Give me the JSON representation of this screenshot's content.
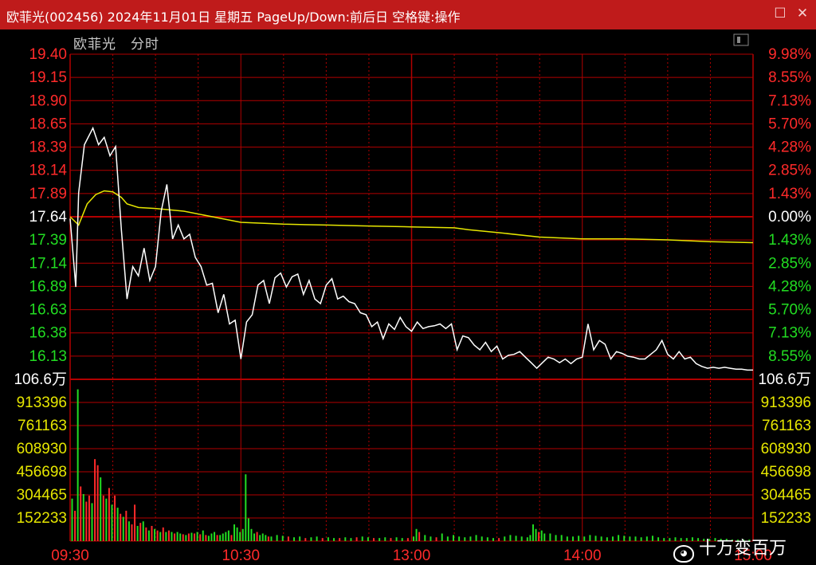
{
  "window": {
    "title": "欧菲光(002456) 2024年11月01日 星期五 PageUp/Down:前后日 空格键:操作",
    "minimize_symbol": "☐",
    "close_symbol": "✕"
  },
  "header": {
    "stock_name": "欧菲光",
    "chart_mode": "分时"
  },
  "watermark": "十万变百万",
  "colors": {
    "titlebar": "#bf1b1b",
    "grid": "#b20000",
    "price_line": "#ffffff",
    "avg_line": "#e6e600",
    "up": "#ff2a2a",
    "down": "#22dd22",
    "neutral": "#ffffff",
    "volume_axis": "#e6e600"
  },
  "chart_data": [
    {
      "type": "line",
      "title": "分时",
      "x_ticks": [
        "09:30",
        "10:30",
        "13:00",
        "14:00",
        "15:00"
      ],
      "prev_close": 17.64,
      "y_ticks_price": [
        "19.40",
        "19.15",
        "18.90",
        "18.65",
        "18.39",
        "18.14",
        "17.89",
        "17.64",
        "17.39",
        "17.14",
        "16.89",
        "16.63",
        "16.38",
        "16.13"
      ],
      "y_ticks_pct": [
        "9.98%",
        "8.55%",
        "7.13%",
        "5.70%",
        "4.28%",
        "2.85%",
        "1.43%",
        "0.00%",
        "1.43%",
        "2.85%",
        "4.28%",
        "5.70%",
        "7.13%",
        "8.55%"
      ],
      "ylim": [
        15.88,
        19.4
      ],
      "series": [
        {
          "kind": "price",
          "x": [
            0,
            2,
            3,
            5,
            8,
            10,
            12,
            14,
            16,
            18,
            20,
            22,
            24,
            26,
            28,
            30,
            32,
            34,
            36,
            38,
            40,
            42,
            44,
            46,
            48,
            50,
            52,
            54,
            56,
            58,
            60,
            62,
            64,
            66,
            68,
            70,
            72,
            74,
            76,
            78,
            80,
            82,
            84,
            86,
            88,
            90,
            92,
            94,
            96,
            98,
            100,
            102,
            104,
            106,
            108,
            110,
            112,
            114,
            116,
            118,
            120,
            122,
            124,
            126,
            128,
            130,
            132,
            134,
            136,
            138,
            140,
            142,
            144,
            146,
            148,
            150,
            152,
            154,
            156,
            158,
            160,
            162,
            164,
            166,
            168,
            170,
            172,
            174,
            176,
            178,
            180,
            182,
            184,
            186,
            188,
            190,
            192,
            194,
            196,
            198,
            200,
            202,
            204,
            206,
            208,
            210,
            212,
            214,
            216,
            218,
            220,
            222,
            224,
            226,
            228,
            230,
            232,
            234,
            236,
            238,
            240
          ],
          "y": [
            17.62,
            16.88,
            17.9,
            18.42,
            18.6,
            18.42,
            18.5,
            18.3,
            18.4,
            17.5,
            16.75,
            17.1,
            17.0,
            17.3,
            16.95,
            17.1,
            17.7,
            17.99,
            17.4,
            17.55,
            17.4,
            17.45,
            17.2,
            17.1,
            16.9,
            16.92,
            16.6,
            16.8,
            16.48,
            16.52,
            16.1,
            16.5,
            16.58,
            16.9,
            16.95,
            16.7,
            16.98,
            17.03,
            16.88,
            16.99,
            17.02,
            16.8,
            16.95,
            16.75,
            16.7,
            16.9,
            16.97,
            16.75,
            16.78,
            16.72,
            16.7,
            16.6,
            16.58,
            16.45,
            16.5,
            16.32,
            16.48,
            16.42,
            16.55,
            16.45,
            16.4,
            16.5,
            16.43,
            16.45,
            16.46,
            16.48,
            16.43,
            16.48,
            16.2,
            16.35,
            16.33,
            16.25,
            16.2,
            16.28,
            16.18,
            16.24,
            16.1,
            16.14,
            16.15,
            16.18,
            16.12,
            16.06,
            16.0,
            16.06,
            16.12,
            16.1,
            16.06,
            16.1,
            16.05,
            16.1,
            16.12,
            16.48,
            16.2,
            16.3,
            16.26,
            16.1,
            16.18,
            16.16,
            16.13,
            16.12,
            16.1,
            16.1,
            16.15,
            16.2,
            16.3,
            16.15,
            16.1,
            16.18,
            16.1,
            16.12,
            16.05,
            16.02,
            16.0,
            16.01,
            16.0,
            16.01,
            16.0,
            15.99,
            15.99,
            15.98,
            15.98
          ],
          "note": "x = trading minutes from 09:30 (0–240)"
        },
        {
          "kind": "average",
          "x": [
            0,
            3,
            6,
            9,
            12,
            15,
            18,
            20,
            24,
            30,
            40,
            50,
            60,
            75,
            90,
            105,
            120,
            135,
            140,
            150,
            165,
            180,
            195,
            210,
            225,
            240
          ],
          "y": [
            17.64,
            17.55,
            17.78,
            17.88,
            17.92,
            17.91,
            17.85,
            17.78,
            17.74,
            17.73,
            17.7,
            17.64,
            17.58,
            17.56,
            17.55,
            17.54,
            17.53,
            17.52,
            17.5,
            17.47,
            17.42,
            17.4,
            17.4,
            17.39,
            17.37,
            17.36
          ]
        }
      ]
    },
    {
      "type": "bar",
      "title": "成交量",
      "y_ticks": [
        "106.6万",
        "913396",
        "761163",
        "608930",
        "456698",
        "304465",
        "152233"
      ],
      "ylim": [
        0,
        1066000
      ],
      "bars": [
        [
          0,
          "g",
          280000
        ],
        [
          1,
          "r",
          200000
        ],
        [
          2,
          "g",
          1000000
        ],
        [
          3,
          "r",
          360000
        ],
        [
          4,
          "g",
          310000
        ],
        [
          5,
          "r",
          260000
        ],
        [
          6,
          "r",
          300000
        ],
        [
          7,
          "g",
          250000
        ],
        [
          8,
          "r",
          540000
        ],
        [
          9,
          "r",
          500000
        ],
        [
          10,
          "g",
          420000
        ],
        [
          11,
          "r",
          300000
        ],
        [
          12,
          "g",
          280000
        ],
        [
          13,
          "r",
          350000
        ],
        [
          14,
          "g",
          240000
        ],
        [
          15,
          "r",
          300000
        ],
        [
          16,
          "g",
          220000
        ],
        [
          17,
          "r",
          180000
        ],
        [
          18,
          "g",
          160000
        ],
        [
          19,
          "r",
          200000
        ],
        [
          20,
          "g",
          130000
        ],
        [
          21,
          "r",
          110000
        ],
        [
          22,
          "r",
          240000
        ],
        [
          23,
          "g",
          100000
        ],
        [
          24,
          "r",
          120000
        ],
        [
          25,
          "g",
          130000
        ],
        [
          26,
          "r",
          90000
        ],
        [
          27,
          "g",
          70000
        ],
        [
          28,
          "r",
          100000
        ],
        [
          29,
          "g",
          80000
        ],
        [
          30,
          "r",
          70000
        ],
        [
          31,
          "g",
          60000
        ],
        [
          32,
          "r",
          90000
        ],
        [
          33,
          "g",
          60000
        ],
        [
          34,
          "r",
          70000
        ],
        [
          35,
          "g",
          60000
        ],
        [
          36,
          "r",
          50000
        ],
        [
          37,
          "g",
          60000
        ],
        [
          38,
          "g",
          50000
        ],
        [
          39,
          "r",
          45000
        ],
        [
          40,
          "g",
          40000
        ],
        [
          41,
          "r",
          50000
        ],
        [
          42,
          "g",
          55000
        ],
        [
          43,
          "r",
          50000
        ],
        [
          44,
          "g",
          60000
        ],
        [
          45,
          "r",
          45000
        ],
        [
          46,
          "g",
          70000
        ],
        [
          47,
          "r",
          40000
        ],
        [
          48,
          "g",
          35000
        ],
        [
          49,
          "g",
          50000
        ],
        [
          50,
          "g",
          60000
        ],
        [
          51,
          "r",
          40000
        ],
        [
          52,
          "g",
          40000
        ],
        [
          53,
          "g",
          50000
        ],
        [
          54,
          "g",
          60000
        ],
        [
          55,
          "g",
          70000
        ],
        [
          56,
          "r",
          40000
        ],
        [
          57,
          "g",
          110000
        ],
        [
          58,
          "g",
          90000
        ],
        [
          59,
          "g",
          60000
        ],
        [
          60,
          "g",
          80000
        ],
        [
          61,
          "g",
          440000
        ],
        [
          62,
          "g",
          150000
        ],
        [
          63,
          "g",
          80000
        ],
        [
          64,
          "g",
          50000
        ],
        [
          65,
          "r",
          60000
        ],
        [
          66,
          "g",
          40000
        ],
        [
          67,
          "g",
          50000
        ],
        [
          68,
          "g",
          40000
        ],
        [
          69,
          "r",
          30000
        ],
        [
          70,
          "g",
          30000
        ],
        [
          72,
          "g",
          40000
        ],
        [
          74,
          "g",
          35000
        ],
        [
          76,
          "r",
          30000
        ],
        [
          78,
          "g",
          25000
        ],
        [
          80,
          "g",
          30000
        ],
        [
          82,
          "r",
          20000
        ],
        [
          84,
          "g",
          25000
        ],
        [
          86,
          "g",
          30000
        ],
        [
          88,
          "r",
          20000
        ],
        [
          90,
          "g",
          25000
        ],
        [
          92,
          "g",
          20000
        ],
        [
          94,
          "r",
          20000
        ],
        [
          96,
          "g",
          25000
        ],
        [
          98,
          "g",
          20000
        ],
        [
          100,
          "r",
          25000
        ],
        [
          102,
          "g",
          30000
        ],
        [
          104,
          "g",
          25000
        ],
        [
          106,
          "r",
          20000
        ],
        [
          108,
          "g",
          20000
        ],
        [
          110,
          "g",
          25000
        ],
        [
          112,
          "r",
          20000
        ],
        [
          114,
          "g",
          25000
        ],
        [
          116,
          "g",
          20000
        ],
        [
          118,
          "r",
          20000
        ],
        [
          120,
          "g",
          30000
        ],
        [
          121,
          "g",
          80000
        ],
        [
          122,
          "r",
          60000
        ],
        [
          124,
          "g",
          40000
        ],
        [
          126,
          "g",
          30000
        ],
        [
          128,
          "r",
          25000
        ],
        [
          130,
          "g",
          50000
        ],
        [
          132,
          "g",
          30000
        ],
        [
          134,
          "g",
          40000
        ],
        [
          136,
          "g",
          30000
        ],
        [
          138,
          "g",
          25000
        ],
        [
          140,
          "g",
          30000
        ],
        [
          142,
          "g",
          40000
        ],
        [
          144,
          "g",
          30000
        ],
        [
          146,
          "g",
          25000
        ],
        [
          148,
          "g",
          20000
        ],
        [
          150,
          "r",
          20000
        ],
        [
          152,
          "g",
          30000
        ],
        [
          154,
          "g",
          40000
        ],
        [
          156,
          "g",
          35000
        ],
        [
          158,
          "g",
          30000
        ],
        [
          160,
          "g",
          25000
        ],
        [
          161,
          "g",
          40000
        ],
        [
          162,
          "g",
          110000
        ],
        [
          163,
          "g",
          80000
        ],
        [
          164,
          "r",
          60000
        ],
        [
          165,
          "g",
          70000
        ],
        [
          166,
          "g",
          50000
        ],
        [
          168,
          "g",
          50000
        ],
        [
          170,
          "g",
          40000
        ],
        [
          172,
          "g",
          40000
        ],
        [
          174,
          "g",
          30000
        ],
        [
          176,
          "g",
          30000
        ],
        [
          178,
          "g",
          35000
        ],
        [
          180,
          "g",
          30000
        ],
        [
          182,
          "g",
          40000
        ],
        [
          184,
          "g",
          35000
        ],
        [
          186,
          "g",
          30000
        ],
        [
          188,
          "g",
          25000
        ],
        [
          190,
          "g",
          30000
        ],
        [
          192,
          "g",
          40000
        ],
        [
          194,
          "g",
          35000
        ],
        [
          196,
          "g",
          30000
        ],
        [
          198,
          "g",
          30000
        ],
        [
          200,
          "g",
          25000
        ],
        [
          202,
          "g",
          30000
        ],
        [
          204,
          "g",
          35000
        ],
        [
          206,
          "g",
          25000
        ],
        [
          208,
          "g",
          20000
        ],
        [
          210,
          "g",
          20000
        ],
        [
          212,
          "g",
          25000
        ],
        [
          214,
          "g",
          20000
        ],
        [
          216,
          "g",
          20000
        ],
        [
          218,
          "g",
          25000
        ],
        [
          220,
          "g",
          20000
        ],
        [
          222,
          "g",
          15000
        ],
        [
          224,
          "g",
          15000
        ],
        [
          226,
          "g",
          20000
        ],
        [
          228,
          "g",
          15000
        ],
        [
          230,
          "g",
          15000
        ],
        [
          232,
          "g",
          10000
        ],
        [
          234,
          "g",
          10000
        ],
        [
          236,
          "g",
          10000
        ],
        [
          238,
          "g",
          10000
        ]
      ]
    }
  ]
}
